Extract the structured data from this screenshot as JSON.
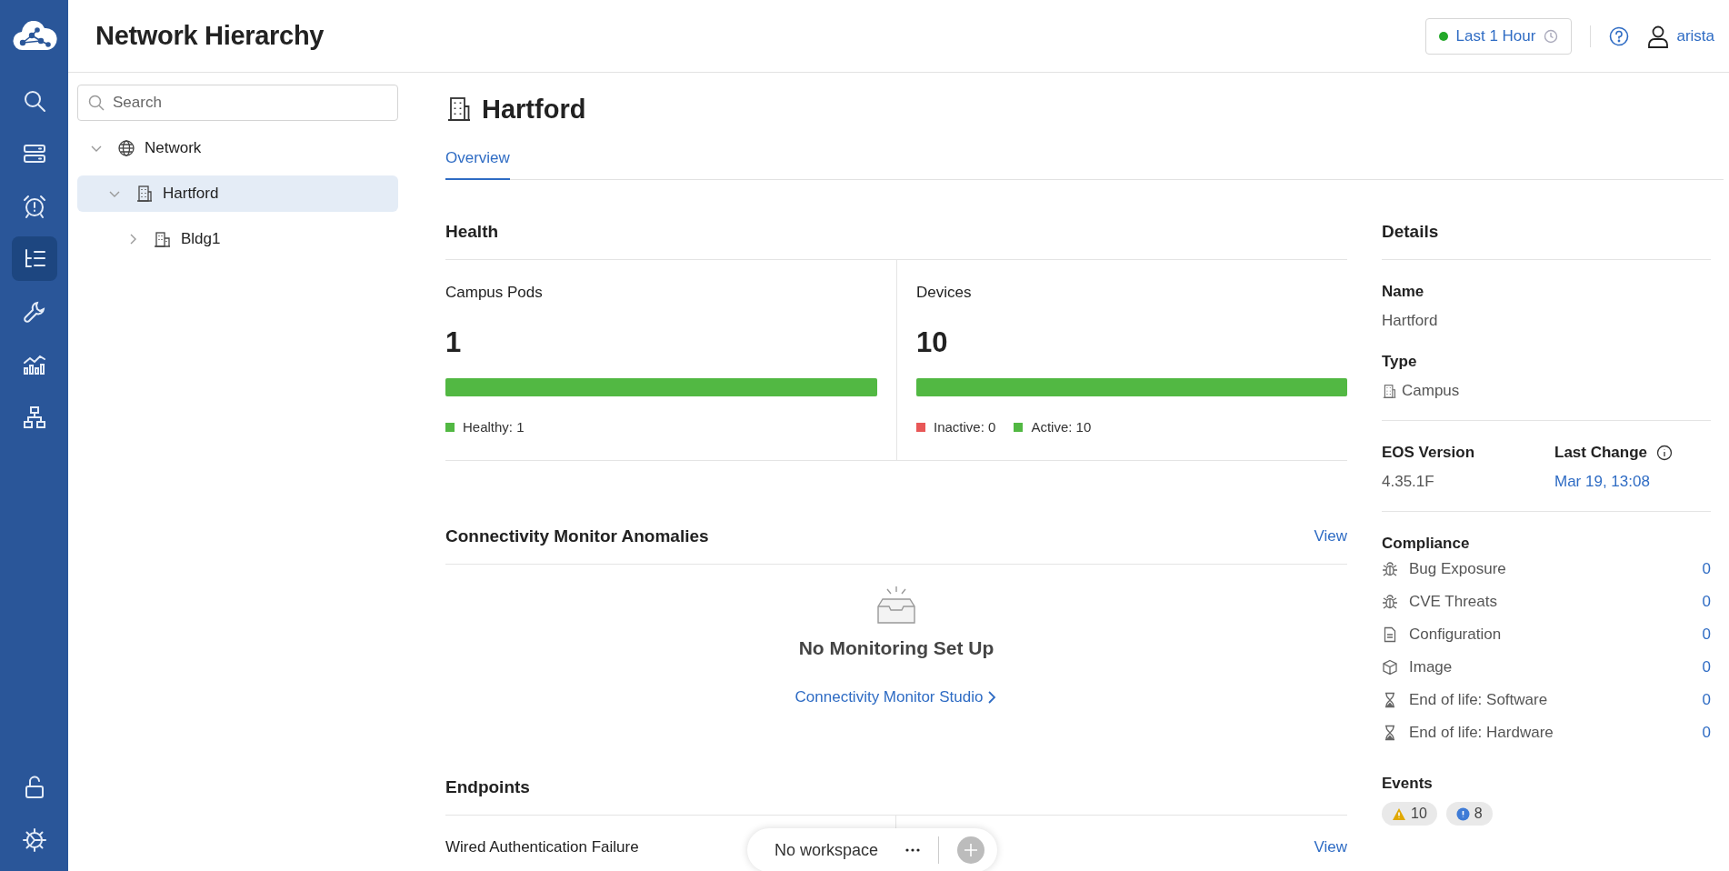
{
  "app": {
    "title": "Network Hierarchy"
  },
  "rail": {
    "items": [
      {
        "kind": "search",
        "selected": false
      },
      {
        "kind": "devices",
        "selected": false
      },
      {
        "kind": "events",
        "selected": false
      },
      {
        "kind": "hierarchy",
        "selected": true
      },
      {
        "kind": "provisioning",
        "selected": false
      },
      {
        "kind": "dashboards",
        "selected": false
      },
      {
        "kind": "topology",
        "selected": false
      }
    ],
    "bottom": [
      {
        "kind": "lock",
        "selected": false
      },
      {
        "kind": "settings",
        "selected": false
      }
    ]
  },
  "header": {
    "time_range": "Last 1 Hour",
    "user": "arista"
  },
  "tree": {
    "search": {
      "placeholder": "Search"
    },
    "nodes": [
      {
        "kind": "network",
        "label": "Network",
        "expanded": true,
        "selected": false,
        "children": [
          {
            "kind": "campus",
            "label": "Hartford",
            "expanded": true,
            "selected": true,
            "children": [
              {
                "kind": "building",
                "label": "Bldg1",
                "expanded": false,
                "selected": false
              }
            ]
          }
        ]
      }
    ]
  },
  "page": {
    "title": "Hartford",
    "tabs": [
      {
        "label": "Overview",
        "selected": true
      }
    ]
  },
  "health": {
    "title": "Health",
    "cards": [
      {
        "label": "Campus Pods",
        "value": "1",
        "level": 1,
        "legend": [
          {
            "label": "Healthy: 1",
            "color": "#52b843"
          }
        ]
      },
      {
        "label": "Devices",
        "value": "10",
        "level": 1,
        "legend": [
          {
            "label": "Inactive: 0",
            "color": "#e85757"
          },
          {
            "label": "Active: 10",
            "color": "#52b843"
          }
        ]
      }
    ]
  },
  "connectivity": {
    "title": "Connectivity Monitor Anomalies",
    "action": "View",
    "empty_title": "No Monitoring Set Up",
    "link": "Connectivity Monitor Studio"
  },
  "endpoints": {
    "title": "Endpoints",
    "rows": [
      {
        "label": "Wired Authentication Failure",
        "action": "View"
      }
    ]
  },
  "details": {
    "title": "Details",
    "name_label": "Name",
    "name": "Hartford",
    "type_label": "Type",
    "type": "Campus",
    "eos_label": "EOS Version",
    "eos": "4.35.1F",
    "change_label": "Last Change",
    "change": "Mar 19, 13:08",
    "compliance_title": "Compliance",
    "compliance": [
      {
        "kind": "bug",
        "label": "Bug Exposure",
        "count": "0"
      },
      {
        "kind": "bug",
        "label": "CVE Threats",
        "count": "0"
      },
      {
        "kind": "file",
        "label": "Configuration",
        "count": "0"
      },
      {
        "kind": "package",
        "label": "Image",
        "count": "0"
      },
      {
        "kind": "hourglass",
        "label": "End of life: Software",
        "count": "0"
      },
      {
        "kind": "hourglass",
        "label": "End of life: Hardware",
        "count": "0"
      }
    ],
    "events_title": "Events",
    "events": [
      {
        "kind": "warning",
        "count": "10"
      },
      {
        "kind": "info",
        "count": "8"
      }
    ]
  },
  "workspace": {
    "label": "No workspace"
  }
}
